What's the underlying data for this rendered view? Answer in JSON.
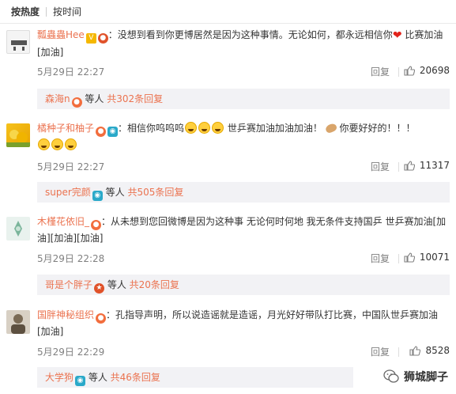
{
  "sort": {
    "hot": "按热度",
    "time": "按时间"
  },
  "comments": [
    {
      "user": "瓢蟲蟲Hee",
      "text_a": "：没想到看到你更博居然是因为这种事情。无论如何，都永远相信你",
      "text_b": " 比赛加油[加油]",
      "time": "5月29日 22:27",
      "reply": "回复",
      "likes": "20698",
      "sub_user": "森海n",
      "sub_mid": " 等人 ",
      "sub_count": "共302条回复"
    },
    {
      "user": "橘种子和柚子",
      "text_a": "：相信你呜呜呜",
      "text_b": " 世乒赛加油加油加油！",
      "text_c": " 你要好好的！！！",
      "time": "5月29日 22:27",
      "reply": "回复",
      "likes": "11317",
      "sub_user": "super完颜",
      "sub_mid": " 等人 ",
      "sub_count": "共505条回复"
    },
    {
      "user": "木槿花依旧_",
      "text_a": "：从未想到您回微博是因为这种事 无论何时何地 我无条件支持国乒 世乒赛加油[加油][加油][加油]",
      "time": "5月29日 22:28",
      "reply": "回复",
      "likes": "10071",
      "sub_user": "哥是个胖子",
      "sub_mid": " 等人 ",
      "sub_count": "共20条回复"
    },
    {
      "user": "国胖神秘组织",
      "text_a": "：孔指导声明，所以说造谣就是造谣，月光好好带队打比赛，中国队世乒赛加油[加油]",
      "time": "5月29日 22:29",
      "reply": "回复",
      "likes": "8528",
      "sub_user": "大学狗",
      "sub_mid": " 等人 ",
      "sub_count": "共46条回复"
    }
  ],
  "watermark": "狮城脚子",
  "colors": {
    "accent": "#eb7350",
    "subbg": "#f2f2f5",
    "meta": "#808080"
  }
}
